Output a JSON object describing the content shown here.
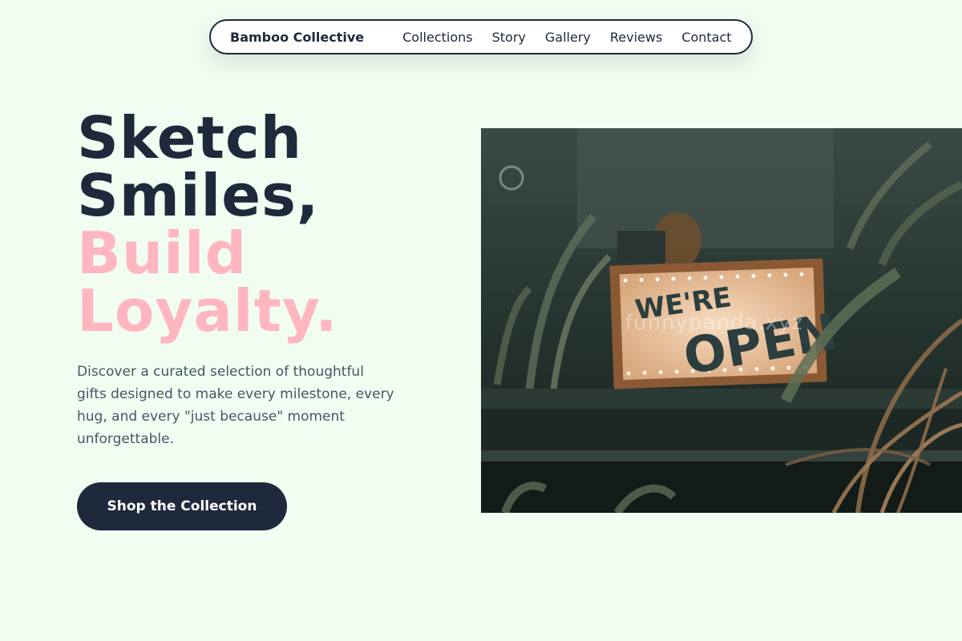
{
  "nav": {
    "brand": "Bamboo Collective",
    "links": [
      "Collections",
      "Story",
      "Gallery",
      "Reviews",
      "Contact"
    ]
  },
  "hero": {
    "headline_line1": "Sketch",
    "headline_line2": "Smiles,",
    "headline_line3": "Build",
    "headline_line4": "Loyalty.",
    "description": "Discover a curated selection of thoughtful gifts designed to make every milestone, every hug, and every \"just because\" moment unforgettable.",
    "cta_label": "Shop the Collection"
  },
  "photo": {
    "sign_top": "WE'RE",
    "sign_main": "OPEN",
    "watermark": "funnypanda.xyz"
  },
  "colors": {
    "background": "#f0fdf0",
    "primary": "#1e293b",
    "accent_pink": "#ffb6c1",
    "body_text": "#475569"
  }
}
